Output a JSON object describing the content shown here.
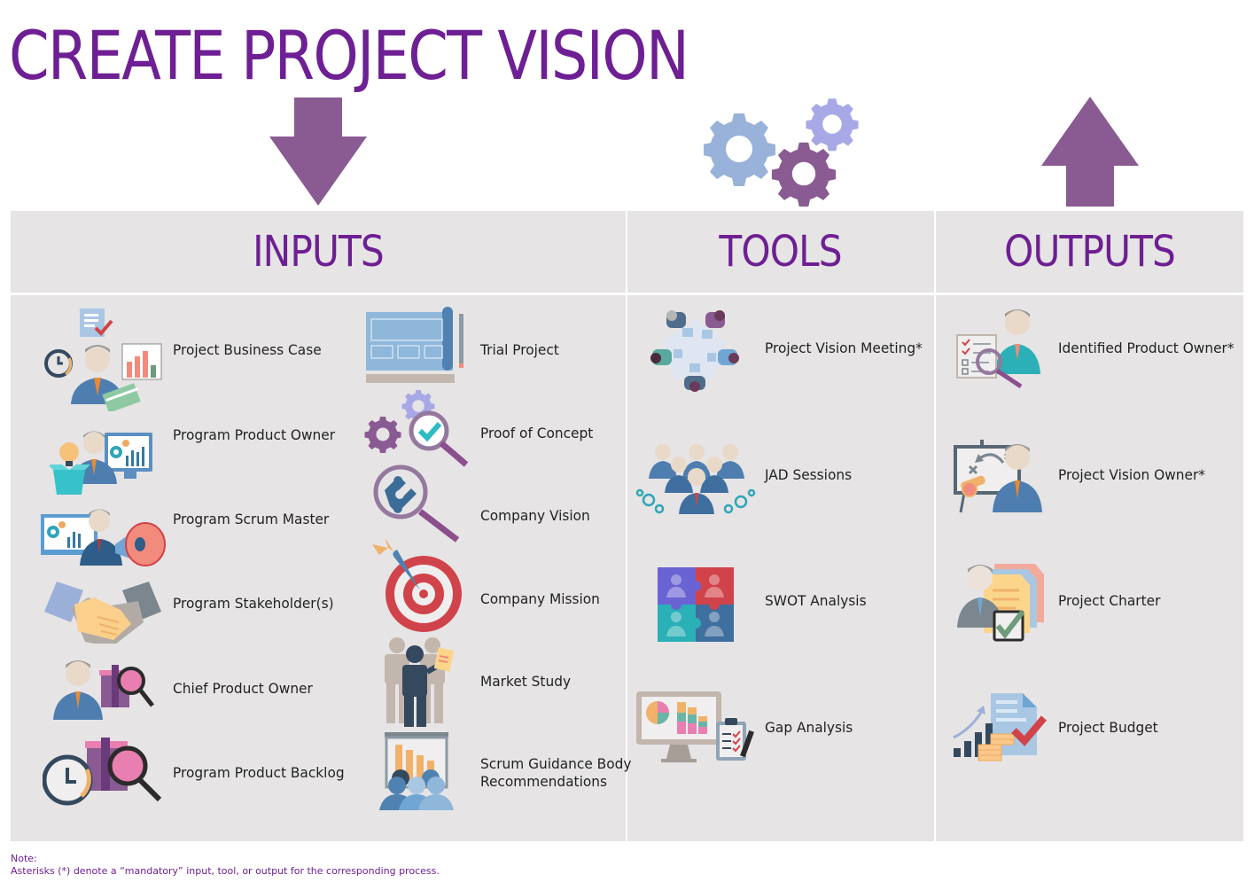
{
  "title": "CREATE PROJECT VISION",
  "colors": {
    "title": "#6e1f93",
    "arrow": "#8a5b92",
    "panel": "#e6e4e5",
    "gear_blue": "#99b2d9",
    "gear_lavender": "#a9a8e6",
    "gear_purple": "#8a5b92"
  },
  "decor": {
    "inputs_arrow": "arrow-down-icon",
    "tools_gears": "gears-icon",
    "outputs_arrow": "arrow-up-icon"
  },
  "columns": {
    "inputs": {
      "title": "INPUTS",
      "items": [
        {
          "label": "Project Business Case",
          "icon": "business-case-icon"
        },
        {
          "label": "Program Product Owner",
          "icon": "product-owner-icon"
        },
        {
          "label": "Program Scrum Master",
          "icon": "scrum-master-megaphone-icon"
        },
        {
          "label": "Program Stakeholder(s)",
          "icon": "handshake-icon"
        },
        {
          "label": "Chief Product Owner",
          "icon": "person-gift-search-icon"
        },
        {
          "label": "Program Product Backlog",
          "icon": "clock-gift-search-icon"
        },
        {
          "label": "Trial Project",
          "icon": "blueprint-icon"
        },
        {
          "label": "Proof of Concept",
          "icon": "gears-checkmark-magnifier-icon"
        },
        {
          "label": "Company Vision",
          "icon": "puzzle-magnifier-icon"
        },
        {
          "label": "Company Mission",
          "icon": "target-dart-icon"
        },
        {
          "label": "Market Study",
          "icon": "people-presentation-icon"
        },
        {
          "label": "Scrum Guidance Body",
          "label2": "Recommendations",
          "icon": "audience-chart-icon"
        }
      ]
    },
    "tools": {
      "title": "TOOLS",
      "items": [
        {
          "label": "Project Vision Meeting*",
          "icon": "meeting-table-icon"
        },
        {
          "label": "JAD Sessions",
          "icon": "team-gears-icon"
        },
        {
          "label": "SWOT Analysis",
          "icon": "puzzle-team-icon"
        },
        {
          "label": "Gap Analysis",
          "icon": "monitor-charts-checklist-icon"
        }
      ]
    },
    "outputs": {
      "title": "OUTPUTS",
      "items": [
        {
          "label": "Identified Product Owner*",
          "icon": "checklist-person-magnifier-icon"
        },
        {
          "label": "Project Vision Owner*",
          "icon": "strategy-board-person-icon"
        },
        {
          "label": "Project Charter",
          "icon": "person-documents-check-icon"
        },
        {
          "label": "Project Budget",
          "icon": "budget-growth-icon"
        }
      ]
    }
  },
  "note": {
    "heading": "Note:",
    "text": "Asterisks (*) denote a “mandatory” input, tool, or output for the corresponding process."
  }
}
